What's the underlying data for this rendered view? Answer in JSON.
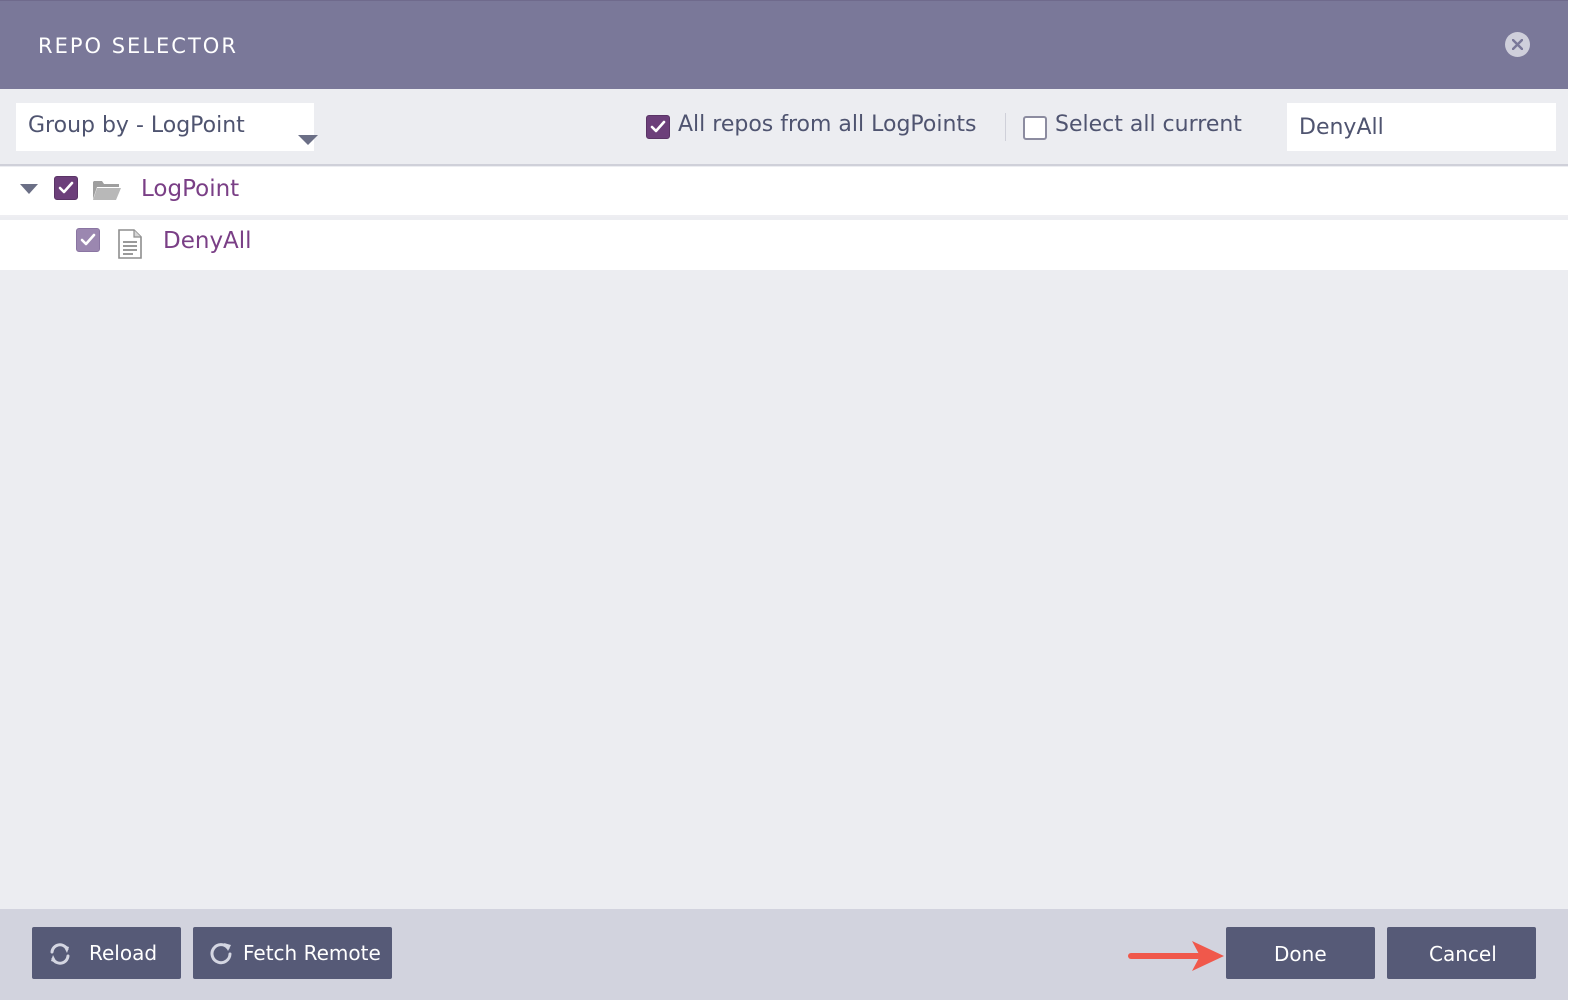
{
  "header": {
    "title": "REPO SELECTOR"
  },
  "toolbar": {
    "group_by_label": "Group by - LogPoint",
    "all_repos_label": "All repos from all LogPoints",
    "all_repos_checked": true,
    "select_all_label": "Select all current",
    "select_all_checked": false,
    "search_value": "DenyAll"
  },
  "tree": {
    "group": {
      "label": "LogPoint",
      "checked": true,
      "expanded": true
    },
    "items": [
      {
        "label": "DenyAll",
        "checked": true
      }
    ]
  },
  "footer": {
    "reload_label": "Reload",
    "fetch_remote_label": "Fetch Remote",
    "done_label": "Done",
    "cancel_label": "Cancel"
  },
  "colors": {
    "header_bg": "#7a7899",
    "button_bg": "#565a77",
    "checkbox_checked": "#6c3f7a",
    "tree_text": "#7a3f86",
    "annotation_arrow": "#f0584b"
  }
}
